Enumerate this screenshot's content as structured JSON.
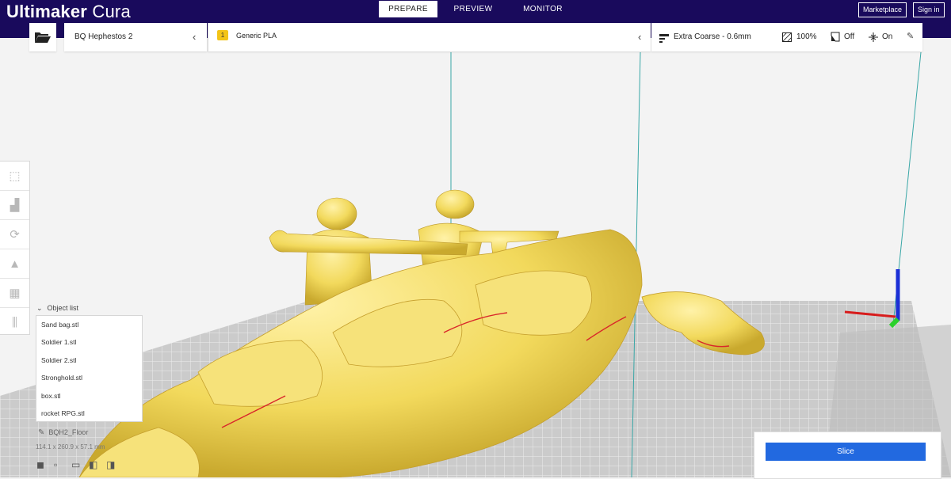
{
  "app": {
    "brand_bold": "Ultimaker",
    "brand_light": " Cura"
  },
  "stages": [
    {
      "label": "PREPARE",
      "active": true
    },
    {
      "label": "PREVIEW",
      "active": false
    },
    {
      "label": "MONITOR",
      "active": false
    }
  ],
  "header_buttons": {
    "marketplace": "Marketplace",
    "signin": "Sign in"
  },
  "printer": {
    "name": "BQ Hephestos 2"
  },
  "material": {
    "extruder": "1",
    "name": "Generic PLA"
  },
  "profile": {
    "quality": "Extra Coarse - 0.6mm",
    "infill": "100%",
    "support": "Off",
    "adhesion": "On"
  },
  "toolbar": {
    "icons": [
      "move-icon",
      "scale-icon",
      "rotate-icon",
      "mirror-icon",
      "per-model-settings-icon",
      "support-blocker-icon"
    ]
  },
  "object_list": {
    "title": "Object list",
    "items": [
      "Sand bag.stl",
      "Soldier 1.stl",
      "Soldier 2.stl",
      "Stronghold.stl",
      "box.stl",
      "rocket RPG.stl"
    ]
  },
  "build_plate": {
    "name": "BQH2_Floor",
    "dimensions": "114.1 x 260.9 x 57.1 mm"
  },
  "slice": {
    "label": "Slice"
  },
  "colors": {
    "header": "#190a5c",
    "accent": "#2269e0",
    "model": "#f4e06a",
    "material_badge": "#f3c417"
  }
}
